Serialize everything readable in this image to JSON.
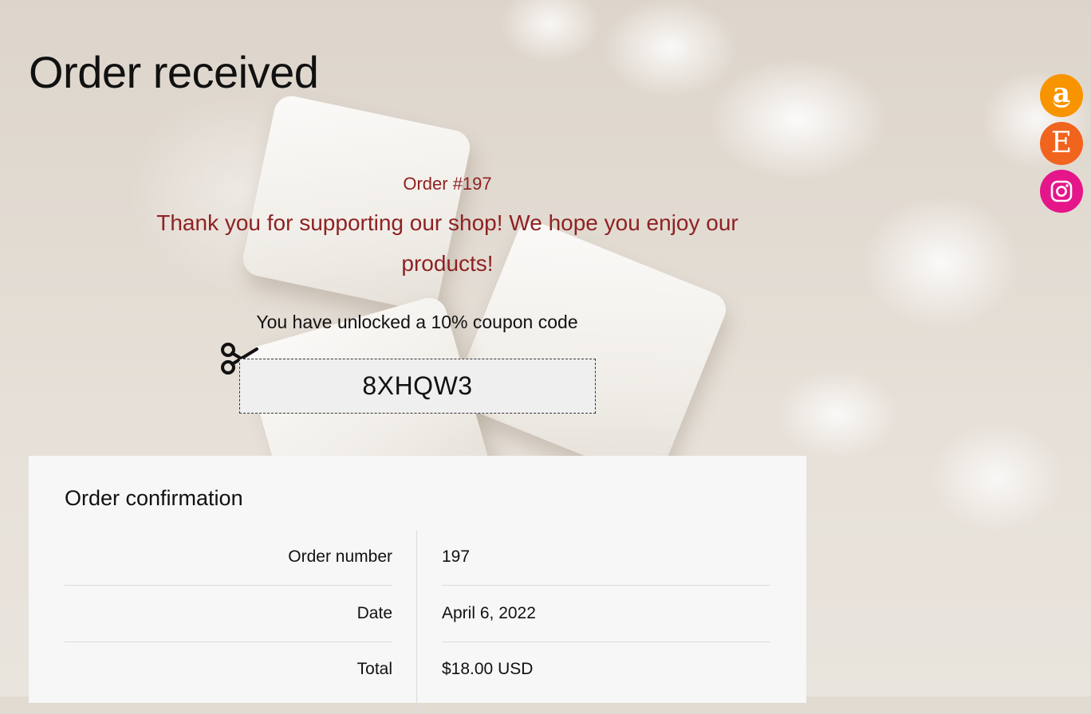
{
  "page": {
    "title": "Order received"
  },
  "social": [
    {
      "name": "amazon",
      "glyph": "a",
      "color": "#f79400"
    },
    {
      "name": "etsy",
      "glyph": "E",
      "color": "#f1641e"
    },
    {
      "name": "instagram",
      "glyph": "instagram-icon",
      "color": "#e4168a"
    }
  ],
  "order_banner": {
    "order_number": "Order #197",
    "message": "Thank you for supporting our shop! We hope you enjoy our products!",
    "coupon_intro": "You have unlocked a 10% coupon code",
    "coupon_code": "8XHQW3"
  },
  "confirmation": {
    "title": "Order confirmation",
    "rows": [
      {
        "label": "Order number",
        "value": "197"
      },
      {
        "label": "Date",
        "value": "April 6, 2022"
      },
      {
        "label": "Total",
        "value": "$18.00 USD"
      }
    ]
  },
  "colors": {
    "accent_text": "#8e2222",
    "panel_bg": "#f7f7f7"
  }
}
